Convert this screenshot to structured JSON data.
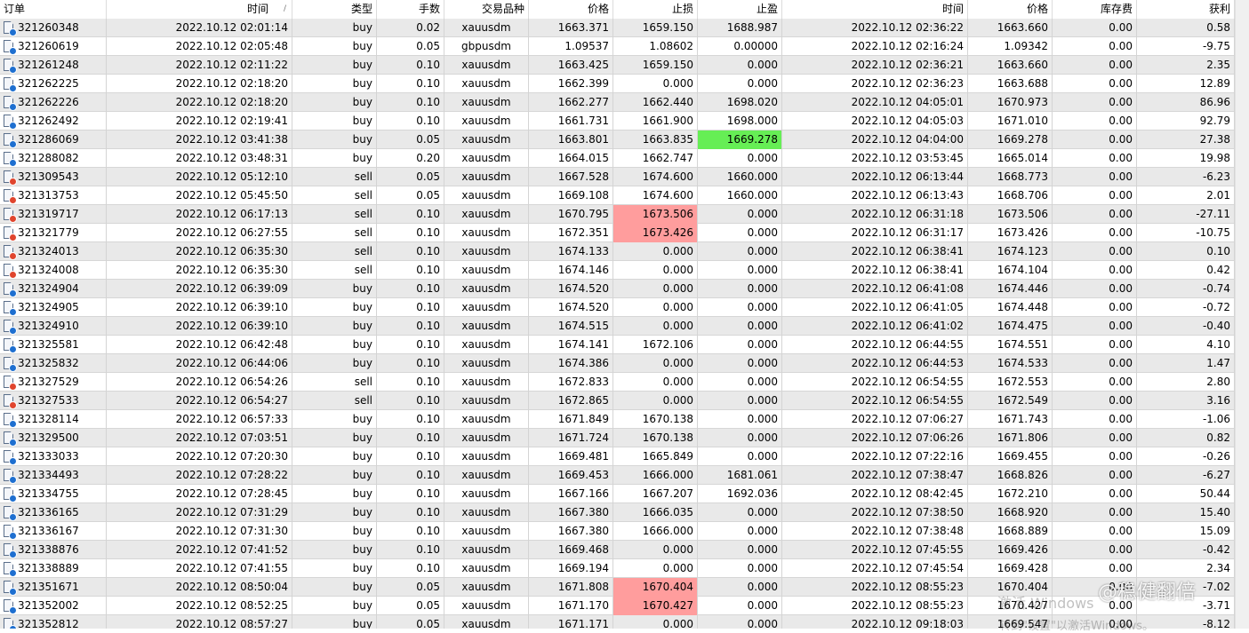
{
  "colors": {
    "stripe_even": "#e9e9e9",
    "stripe_odd": "#ffffff",
    "highlight_red": "#ff9d9d",
    "highlight_green": "#66ee55",
    "buy_dot": "#1e6fd0",
    "sell_dot": "#e0452e"
  },
  "columns": [
    {
      "key": "order",
      "label": "订单"
    },
    {
      "key": "open_time",
      "label": "时间",
      "sort": "/"
    },
    {
      "key": "type",
      "label": "类型"
    },
    {
      "key": "lots",
      "label": "手数"
    },
    {
      "key": "symbol",
      "label": "交易品种"
    },
    {
      "key": "open_price",
      "label": "价格"
    },
    {
      "key": "sl",
      "label": "止损"
    },
    {
      "key": "tp",
      "label": "止盈"
    },
    {
      "key": "close_time",
      "label": "时间"
    },
    {
      "key": "close_price",
      "label": "价格"
    },
    {
      "key": "swap",
      "label": "库存费"
    },
    {
      "key": "profit",
      "label": "获利"
    }
  ],
  "rows": [
    {
      "order": "321260348",
      "open_time": "2022.10.12 02:01:14",
      "type": "buy",
      "lots": "0.02",
      "symbol": "xauusdm",
      "open_price": "1663.371",
      "sl": "1659.150",
      "tp": "1688.987",
      "close_time": "2022.10.12 02:36:22",
      "close_price": "1663.660",
      "swap": "0.00",
      "profit": "0.58"
    },
    {
      "order": "321260619",
      "open_time": "2022.10.12 02:05:48",
      "type": "buy",
      "lots": "0.05",
      "symbol": "gbpusdm",
      "open_price": "1.09537",
      "sl": "1.08602",
      "tp": "0.00000",
      "close_time": "2022.10.12 02:16:24",
      "close_price": "1.09342",
      "swap": "0.00",
      "profit": "-9.75"
    },
    {
      "order": "321261248",
      "open_time": "2022.10.12 02:11:22",
      "type": "buy",
      "lots": "0.10",
      "symbol": "xauusdm",
      "open_price": "1663.425",
      "sl": "1659.150",
      "tp": "0.000",
      "close_time": "2022.10.12 02:36:21",
      "close_price": "1663.660",
      "swap": "0.00",
      "profit": "2.35"
    },
    {
      "order": "321262225",
      "open_time": "2022.10.12 02:18:20",
      "type": "buy",
      "lots": "0.10",
      "symbol": "xauusdm",
      "open_price": "1662.399",
      "sl": "0.000",
      "tp": "0.000",
      "close_time": "2022.10.12 02:36:23",
      "close_price": "1663.688",
      "swap": "0.00",
      "profit": "12.89"
    },
    {
      "order": "321262226",
      "open_time": "2022.10.12 02:18:20",
      "type": "buy",
      "lots": "0.10",
      "symbol": "xauusdm",
      "open_price": "1662.277",
      "sl": "1662.440",
      "tp": "1698.020",
      "close_time": "2022.10.12 04:05:01",
      "close_price": "1670.973",
      "swap": "0.00",
      "profit": "86.96"
    },
    {
      "order": "321262492",
      "open_time": "2022.10.12 02:19:41",
      "type": "buy",
      "lots": "0.10",
      "symbol": "xauusdm",
      "open_price": "1661.731",
      "sl": "1661.900",
      "tp": "1698.000",
      "close_time": "2022.10.12 04:05:03",
      "close_price": "1671.010",
      "swap": "0.00",
      "profit": "92.79"
    },
    {
      "order": "321286069",
      "open_time": "2022.10.12 03:41:38",
      "type": "buy",
      "lots": "0.05",
      "symbol": "xauusdm",
      "open_price": "1663.801",
      "sl": "1663.835",
      "tp": "1669.278",
      "close_time": "2022.10.12 04:04:00",
      "close_price": "1669.278",
      "swap": "0.00",
      "profit": "27.38",
      "hl": "tp"
    },
    {
      "order": "321288082",
      "open_time": "2022.10.12 03:48:31",
      "type": "buy",
      "lots": "0.20",
      "symbol": "xauusdm",
      "open_price": "1664.015",
      "sl": "1662.747",
      "tp": "0.000",
      "close_time": "2022.10.12 03:53:45",
      "close_price": "1665.014",
      "swap": "0.00",
      "profit": "19.98"
    },
    {
      "order": "321309543",
      "open_time": "2022.10.12 05:12:10",
      "type": "sell",
      "lots": "0.05",
      "symbol": "xauusdm",
      "open_price": "1667.528",
      "sl": "1674.600",
      "tp": "1660.000",
      "close_time": "2022.10.12 06:13:44",
      "close_price": "1668.773",
      "swap": "0.00",
      "profit": "-6.23"
    },
    {
      "order": "321313753",
      "open_time": "2022.10.12 05:45:50",
      "type": "sell",
      "lots": "0.05",
      "symbol": "xauusdm",
      "open_price": "1669.108",
      "sl": "1674.600",
      "tp": "1660.000",
      "close_time": "2022.10.12 06:13:43",
      "close_price": "1668.706",
      "swap": "0.00",
      "profit": "2.01"
    },
    {
      "order": "321319717",
      "open_time": "2022.10.12 06:17:13",
      "type": "sell",
      "lots": "0.10",
      "symbol": "xauusdm",
      "open_price": "1670.795",
      "sl": "1673.506",
      "tp": "0.000",
      "close_time": "2022.10.12 06:31:18",
      "close_price": "1673.506",
      "swap": "0.00",
      "profit": "-27.11",
      "hl": "sl"
    },
    {
      "order": "321321779",
      "open_time": "2022.10.12 06:27:55",
      "type": "sell",
      "lots": "0.10",
      "symbol": "xauusdm",
      "open_price": "1672.351",
      "sl": "1673.426",
      "tp": "0.000",
      "close_time": "2022.10.12 06:31:17",
      "close_price": "1673.426",
      "swap": "0.00",
      "profit": "-10.75",
      "hl": "sl"
    },
    {
      "order": "321324013",
      "open_time": "2022.10.12 06:35:30",
      "type": "sell",
      "lots": "0.10",
      "symbol": "xauusdm",
      "open_price": "1674.133",
      "sl": "0.000",
      "tp": "0.000",
      "close_time": "2022.10.12 06:38:41",
      "close_price": "1674.123",
      "swap": "0.00",
      "profit": "0.10"
    },
    {
      "order": "321324008",
      "open_time": "2022.10.12 06:35:30",
      "type": "sell",
      "lots": "0.10",
      "symbol": "xauusdm",
      "open_price": "1674.146",
      "sl": "0.000",
      "tp": "0.000",
      "close_time": "2022.10.12 06:38:41",
      "close_price": "1674.104",
      "swap": "0.00",
      "profit": "0.42"
    },
    {
      "order": "321324904",
      "open_time": "2022.10.12 06:39:09",
      "type": "buy",
      "lots": "0.10",
      "symbol": "xauusdm",
      "open_price": "1674.520",
      "sl": "0.000",
      "tp": "0.000",
      "close_time": "2022.10.12 06:41:08",
      "close_price": "1674.446",
      "swap": "0.00",
      "profit": "-0.74"
    },
    {
      "order": "321324905",
      "open_time": "2022.10.12 06:39:10",
      "type": "buy",
      "lots": "0.10",
      "symbol": "xauusdm",
      "open_price": "1674.520",
      "sl": "0.000",
      "tp": "0.000",
      "close_time": "2022.10.12 06:41:05",
      "close_price": "1674.448",
      "swap": "0.00",
      "profit": "-0.72"
    },
    {
      "order": "321324910",
      "open_time": "2022.10.12 06:39:10",
      "type": "buy",
      "lots": "0.10",
      "symbol": "xauusdm",
      "open_price": "1674.515",
      "sl": "0.000",
      "tp": "0.000",
      "close_time": "2022.10.12 06:41:02",
      "close_price": "1674.475",
      "swap": "0.00",
      "profit": "-0.40"
    },
    {
      "order": "321325581",
      "open_time": "2022.10.12 06:42:48",
      "type": "buy",
      "lots": "0.10",
      "symbol": "xauusdm",
      "open_price": "1674.141",
      "sl": "1672.106",
      "tp": "0.000",
      "close_time": "2022.10.12 06:44:55",
      "close_price": "1674.551",
      "swap": "0.00",
      "profit": "4.10"
    },
    {
      "order": "321325832",
      "open_time": "2022.10.12 06:44:06",
      "type": "buy",
      "lots": "0.10",
      "symbol": "xauusdm",
      "open_price": "1674.386",
      "sl": "0.000",
      "tp": "0.000",
      "close_time": "2022.10.12 06:44:53",
      "close_price": "1674.533",
      "swap": "0.00",
      "profit": "1.47"
    },
    {
      "order": "321327529",
      "open_time": "2022.10.12 06:54:26",
      "type": "sell",
      "lots": "0.10",
      "symbol": "xauusdm",
      "open_price": "1672.833",
      "sl": "0.000",
      "tp": "0.000",
      "close_time": "2022.10.12 06:54:55",
      "close_price": "1672.553",
      "swap": "0.00",
      "profit": "2.80"
    },
    {
      "order": "321327533",
      "open_time": "2022.10.12 06:54:27",
      "type": "sell",
      "lots": "0.10",
      "symbol": "xauusdm",
      "open_price": "1672.865",
      "sl": "0.000",
      "tp": "0.000",
      "close_time": "2022.10.12 06:54:55",
      "close_price": "1672.549",
      "swap": "0.00",
      "profit": "3.16"
    },
    {
      "order": "321328114",
      "open_time": "2022.10.12 06:57:33",
      "type": "buy",
      "lots": "0.10",
      "symbol": "xauusdm",
      "open_price": "1671.849",
      "sl": "1670.138",
      "tp": "0.000",
      "close_time": "2022.10.12 07:06:27",
      "close_price": "1671.743",
      "swap": "0.00",
      "profit": "-1.06"
    },
    {
      "order": "321329500",
      "open_time": "2022.10.12 07:03:51",
      "type": "buy",
      "lots": "0.10",
      "symbol": "xauusdm",
      "open_price": "1671.724",
      "sl": "1670.138",
      "tp": "0.000",
      "close_time": "2022.10.12 07:06:26",
      "close_price": "1671.806",
      "swap": "0.00",
      "profit": "0.82"
    },
    {
      "order": "321333033",
      "open_time": "2022.10.12 07:20:30",
      "type": "buy",
      "lots": "0.10",
      "symbol": "xauusdm",
      "open_price": "1669.481",
      "sl": "1665.849",
      "tp": "0.000",
      "close_time": "2022.10.12 07:22:16",
      "close_price": "1669.455",
      "swap": "0.00",
      "profit": "-0.26"
    },
    {
      "order": "321334493",
      "open_time": "2022.10.12 07:28:22",
      "type": "buy",
      "lots": "0.10",
      "symbol": "xauusdm",
      "open_price": "1669.453",
      "sl": "1666.000",
      "tp": "1681.061",
      "close_time": "2022.10.12 07:38:47",
      "close_price": "1668.826",
      "swap": "0.00",
      "profit": "-6.27"
    },
    {
      "order": "321334755",
      "open_time": "2022.10.12 07:28:45",
      "type": "buy",
      "lots": "0.10",
      "symbol": "xauusdm",
      "open_price": "1667.166",
      "sl": "1667.207",
      "tp": "1692.036",
      "close_time": "2022.10.12 08:42:45",
      "close_price": "1672.210",
      "swap": "0.00",
      "profit": "50.44"
    },
    {
      "order": "321336165",
      "open_time": "2022.10.12 07:31:29",
      "type": "buy",
      "lots": "0.10",
      "symbol": "xauusdm",
      "open_price": "1667.380",
      "sl": "1666.035",
      "tp": "0.000",
      "close_time": "2022.10.12 07:38:50",
      "close_price": "1668.920",
      "swap": "0.00",
      "profit": "15.40"
    },
    {
      "order": "321336167",
      "open_time": "2022.10.12 07:31:30",
      "type": "buy",
      "lots": "0.10",
      "symbol": "xauusdm",
      "open_price": "1667.380",
      "sl": "1666.000",
      "tp": "0.000",
      "close_time": "2022.10.12 07:38:48",
      "close_price": "1668.889",
      "swap": "0.00",
      "profit": "15.09"
    },
    {
      "order": "321338876",
      "open_time": "2022.10.12 07:41:52",
      "type": "buy",
      "lots": "0.10",
      "symbol": "xauusdm",
      "open_price": "1669.468",
      "sl": "0.000",
      "tp": "0.000",
      "close_time": "2022.10.12 07:45:55",
      "close_price": "1669.426",
      "swap": "0.00",
      "profit": "-0.42"
    },
    {
      "order": "321338889",
      "open_time": "2022.10.12 07:41:55",
      "type": "buy",
      "lots": "0.10",
      "symbol": "xauusdm",
      "open_price": "1669.194",
      "sl": "0.000",
      "tp": "0.000",
      "close_time": "2022.10.12 07:45:54",
      "close_price": "1669.428",
      "swap": "0.00",
      "profit": "2.34"
    },
    {
      "order": "321351671",
      "open_time": "2022.10.12 08:50:04",
      "type": "buy",
      "lots": "0.05",
      "symbol": "xauusdm",
      "open_price": "1671.808",
      "sl": "1670.404",
      "tp": "0.000",
      "close_time": "2022.10.12 08:55:23",
      "close_price": "1670.404",
      "swap": "0.00",
      "profit": "-7.02",
      "hl": "sl"
    },
    {
      "order": "321352002",
      "open_time": "2022.10.12 08:52:25",
      "type": "buy",
      "lots": "0.05",
      "symbol": "xauusdm",
      "open_price": "1671.170",
      "sl": "1670.427",
      "tp": "0.000",
      "close_time": "2022.10.12 08:55:23",
      "close_price": "1670.427",
      "swap": "0.00",
      "profit": "-3.71",
      "hl": "sl"
    },
    {
      "order": "321352812",
      "open_time": "2022.10.12 08:57:27",
      "type": "buy",
      "lots": "0.05",
      "symbol": "xauusdm",
      "open_price": "1671.171",
      "sl": "0.000",
      "tp": "0.000",
      "close_time": "2022.10.12 09:18:03",
      "close_price": "1669.547",
      "swap": "0.00",
      "profit": "-8.12"
    }
  ],
  "watermark": {
    "windows_line1": "激活 Windows",
    "windows_line2": "转到\"设置\"以激活Windows。",
    "brand": "@稳健翻倍"
  }
}
